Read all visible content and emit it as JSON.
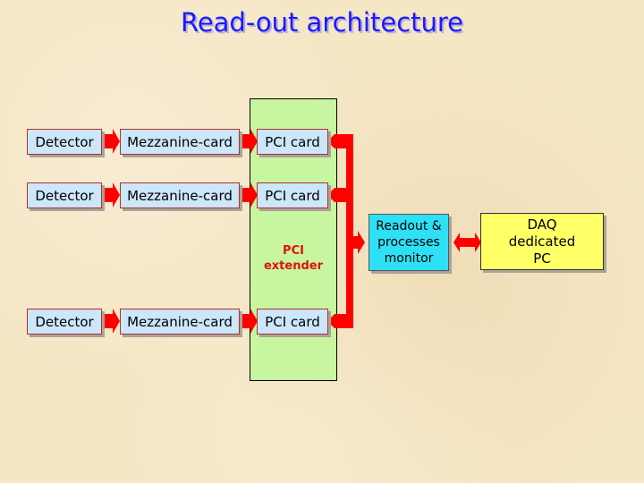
{
  "title": "Read-out architecture",
  "rows": [
    {
      "detector": "Detector",
      "mezzanine": "Mezzanine-card",
      "pci": "PCI card"
    },
    {
      "detector": "Detector",
      "mezzanine": "Mezzanine-card",
      "pci": "PCI card"
    },
    {
      "detector": "Detector",
      "mezzanine": "Mezzanine-card",
      "pci": "PCI card"
    }
  ],
  "extender_label": [
    "PCI",
    "extender"
  ],
  "readout_label": [
    "Readout &",
    "processes",
    "monitor"
  ],
  "daq_label": [
    "DAQ",
    "dedicated",
    "PC"
  ],
  "colors": {
    "arrow": "#ff0000",
    "extender": "#c8f5a0",
    "card": "#cce6fa",
    "readout": "#2ee0f5",
    "daq": "#ffff66",
    "title": "#1a1aff"
  }
}
